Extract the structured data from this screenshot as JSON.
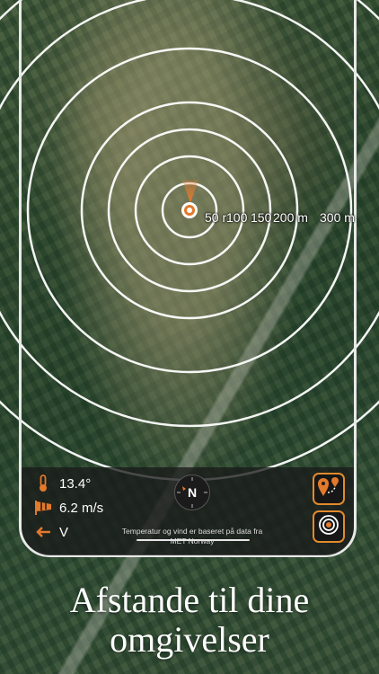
{
  "map": {
    "distance_labels": [
      "50 r",
      "100",
      "150",
      "200 m",
      "300 m"
    ]
  },
  "weather": {
    "temperature": "13.4°",
    "wind_speed": "6.2 m/s",
    "wind_direction": "V"
  },
  "compass": {
    "heading_letter": "N"
  },
  "credit": {
    "text": "Temperatur og vind er baseret på data fra MET Norway"
  },
  "caption": {
    "line1": "Afstande til dine",
    "line2": "omgivelser"
  },
  "colors": {
    "accent": "#e3792b",
    "ring": "#ffffff",
    "panel": "#1b1b1b"
  },
  "icons": {
    "temperature": "thermometer-icon",
    "wind": "windsock-icon",
    "direction": "arrow-left-icon",
    "compass": "compass-icon",
    "route": "route-pins-icon",
    "rings": "target-rings-icon"
  }
}
